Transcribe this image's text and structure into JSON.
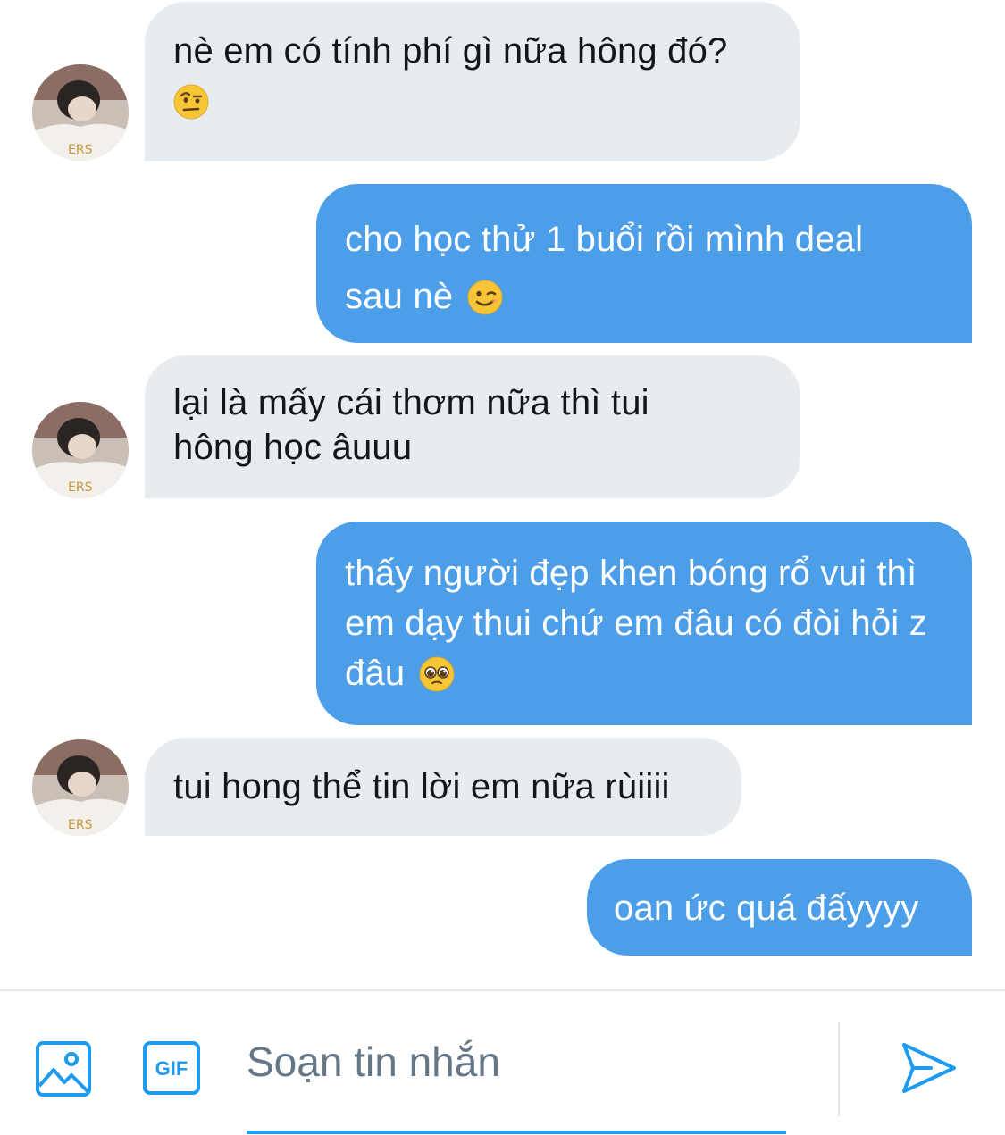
{
  "conversation": {
    "messages": [
      {
        "sender": "other",
        "text": "nè em có tính phí gì nữa hông đó?",
        "emoji": "face-with-raised-eyebrow"
      },
      {
        "sender": "me",
        "text": "cho học thử 1 buổi rồi mình deal sau nè",
        "emoji": "winking-face"
      },
      {
        "sender": "other",
        "text": "lại là mấy cái thơm nữa thì tui hông học âuuu"
      },
      {
        "sender": "me",
        "text": "thấy người đẹp khen bóng rổ vui thì em dạy thui chứ em đâu có đòi hỏi z đâu",
        "emoji": "pleading-face"
      },
      {
        "sender": "other",
        "text": "tui hong thể tin lời em nữa rùiiii"
      },
      {
        "sender": "me",
        "text": "oan ức quá đấyyyy"
      }
    ]
  },
  "composer": {
    "placeholder": "Soạn tin nhắn",
    "icons": {
      "media": "image-icon",
      "gif": "gif-icon",
      "send": "send-icon"
    },
    "gif_label": "GIF"
  },
  "colors": {
    "incoming_bubble": "#e6ecf0",
    "outgoing_bubble": "#4d9ee8",
    "accent": "#1da1f2"
  }
}
